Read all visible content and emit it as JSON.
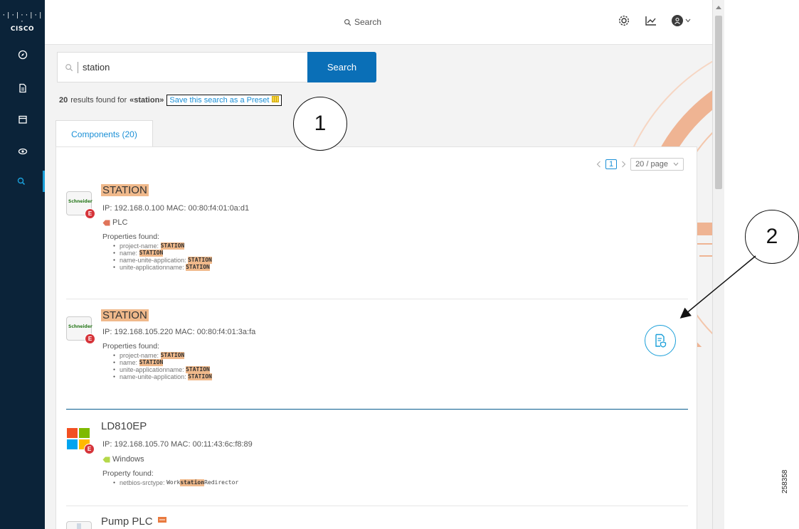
{
  "app": {
    "logo_bars": "·|·|··|·|·",
    "logo_text": "CISCO"
  },
  "sidebar": {
    "items": [
      {
        "icon": "compass-icon",
        "active": false
      },
      {
        "icon": "document-icon",
        "active": false
      },
      {
        "icon": "calendar-icon",
        "active": false
      },
      {
        "icon": "eye-icon",
        "active": false
      },
      {
        "icon": "search-icon",
        "active": true
      }
    ]
  },
  "topbar": {
    "search_label": "Search",
    "icons": [
      "gear-icon",
      "chart-icon",
      "user-avatar-icon"
    ]
  },
  "search": {
    "value": "station",
    "button_label": "Search"
  },
  "results": {
    "count": "20",
    "text": "results found for",
    "query": "«station»",
    "preset_link": "Save this search as a Preset"
  },
  "tab": {
    "label": "Components (20)"
  },
  "pagination": {
    "current_page": "1",
    "page_size": "20 / page"
  },
  "components": [
    {
      "name": "STATION",
      "brand": "Schneider",
      "badge": "E",
      "ip_mac": "IP: 192.168.0.100   MAC: 00:80:f4:01:0a:d1",
      "tag": "PLC",
      "props_title": "Properties found:",
      "props": [
        {
          "key": "project-name:",
          "value": "STATION"
        },
        {
          "key": "name:",
          "value": "STATION"
        },
        {
          "key": "name-unite-application:",
          "value": "STATION"
        },
        {
          "key": "unite-applicationname:",
          "value": "STATION"
        }
      ]
    },
    {
      "name": "STATION",
      "brand": "Schneider",
      "badge": "E",
      "ip_mac": "IP: 192.168.105.220   MAC: 00:80:f4:01:3a:fa",
      "props_title": "Properties found:",
      "props": [
        {
          "key": "project-name:",
          "value": "STATION"
        },
        {
          "key": "name:",
          "value": "STATION"
        },
        {
          "key": "unite-applicationname:",
          "value": "STATION"
        },
        {
          "key": "name-unite-application:",
          "value": "STATION"
        }
      ]
    },
    {
      "name": "LD810EP",
      "badge": "E",
      "ip_mac": "IP: 192.168.105.70   MAC: 00:11:43:6c:f8:89",
      "tag": "Windows",
      "props_title": "Property found:",
      "prop_key": "netbios-srctype:",
      "prop_pre": "Work",
      "prop_hl": "station",
      "prop_post": "Redirector"
    },
    {
      "name": "Pump PLC"
    }
  ],
  "callouts": {
    "one": "1",
    "two": "2"
  },
  "figure_id": "258358",
  "colors": {
    "sidebar": "#0b2339",
    "primary": "#0a6fb7",
    "highlight": "#f0b98b",
    "badge": "#d6343a",
    "link": "#1a8fd6"
  }
}
